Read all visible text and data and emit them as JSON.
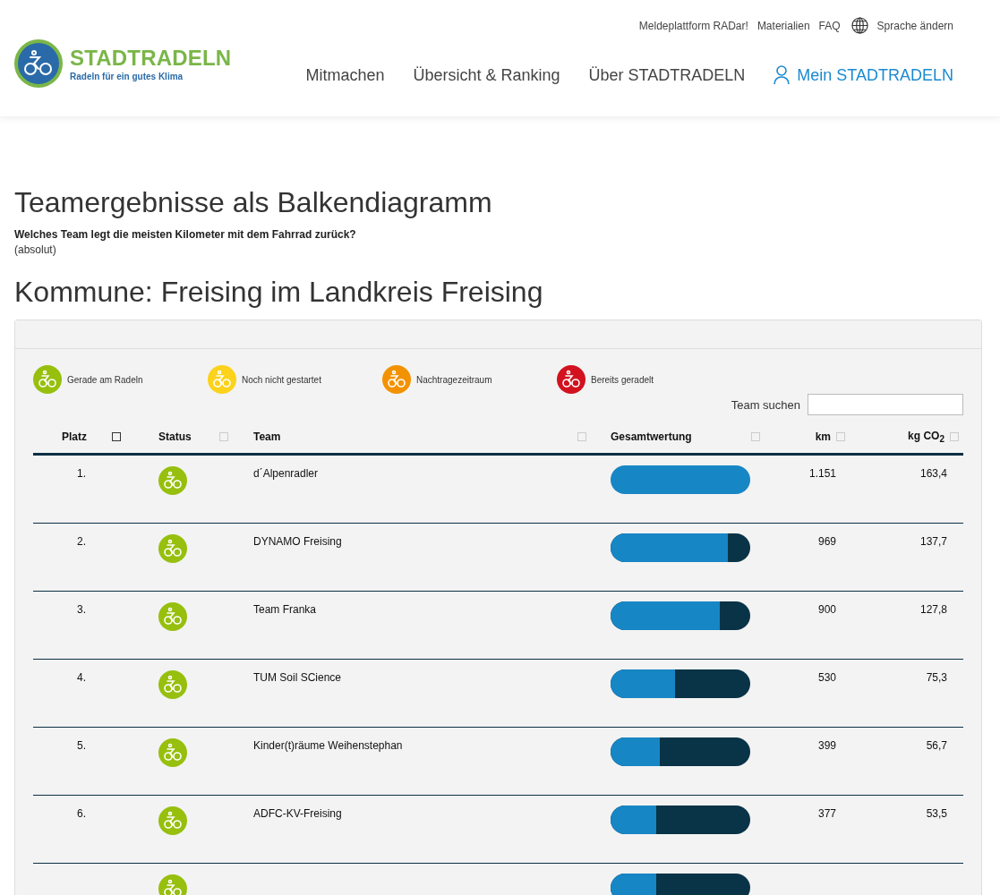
{
  "topbar": {
    "links": [
      "Meldeplattform RADar!",
      "Materialien",
      "FAQ"
    ],
    "language": "Sprache ändern"
  },
  "logo": {
    "name": "STADTRADELN",
    "tagline": "Radeln für ein gutes Klima"
  },
  "nav": [
    {
      "label": "Mitmachen",
      "selected": false
    },
    {
      "label": "Übersicht & Ranking",
      "selected": false
    },
    {
      "label": "Über STADTRADELN",
      "selected": false
    },
    {
      "label": "Mein STADTRADELN",
      "selected": true
    }
  ],
  "heading": "Teamergebnisse als Balkendiagramm",
  "question": "Welches Team legt die meisten Kilometer mit dem Fahrrad zurück?",
  "note": "(absolut)",
  "commune": "Kommune: Freising im Landkreis Freising",
  "legend": [
    {
      "label": "Gerade am Radeln",
      "color": "#97bf0d"
    },
    {
      "label": "Noch nicht gestartet",
      "color": "#fcd21c"
    },
    {
      "label": "Nachtragezeitraum",
      "color": "#f39200"
    },
    {
      "label": "Bereits geradelt",
      "color": "#d2121f"
    }
  ],
  "search": {
    "label": "Team suchen"
  },
  "columns": [
    {
      "label": "Platz",
      "selected": true
    },
    {
      "label": "Status",
      "selected": false
    },
    {
      "label": "Team",
      "selected": false
    },
    {
      "label": "Gesamtwertung",
      "selected": false
    },
    {
      "label": "km",
      "selected": false
    },
    {
      "label": "kg CO$_{2}$",
      "selected": false
    }
  ],
  "rows": [
    {
      "rank": "1.",
      "color": "#97bf0d",
      "team": "d´Alpenradler",
      "level": 1.0,
      "km": "1.151",
      "co2": "163,4"
    },
    {
      "rank": "2.",
      "color": "#97bf0d",
      "team": "DYNAMO Freising",
      "level": 0.84,
      "km": "969",
      "co2": "137,7"
    },
    {
      "rank": "3.",
      "color": "#97bf0d",
      "team": "Team Franka",
      "level": 0.78,
      "km": "900",
      "co2": "127,8"
    },
    {
      "rank": "4.",
      "color": "#97bf0d",
      "team": "TUM Soil SCience",
      "level": 0.46,
      "km": "530",
      "co2": "75,3"
    },
    {
      "rank": "5.",
      "color": "#97bf0d",
      "team": "Kinder(t)räume Weihenstephan",
      "level": 0.35,
      "km": "399",
      "co2": "56,7"
    },
    {
      "rank": "6.",
      "color": "#97bf0d",
      "team": "ADFC-KV-Freising",
      "level": 0.33,
      "km": "377",
      "co2": "53,5"
    },
    {
      "color": "#97bf0d",
      "level": 0.33
    }
  ]
}
